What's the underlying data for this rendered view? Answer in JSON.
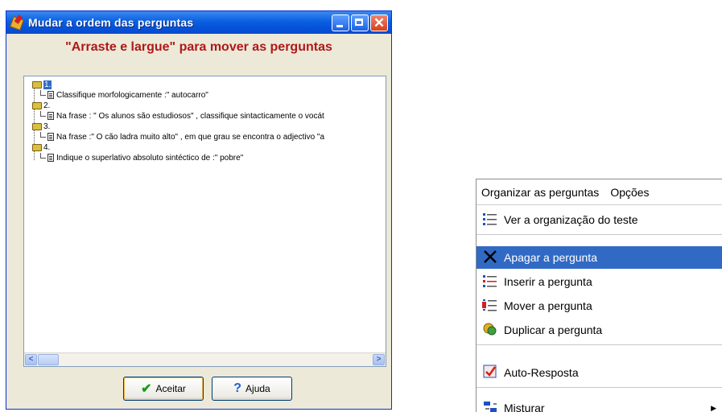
{
  "dialog": {
    "title": "Mudar a ordem das perguntas",
    "heading": "\"Arraste e largue\" para mover as perguntas",
    "questions": [
      {
        "number": "1.",
        "text": "Classifique morfologicamente :\" autocarro\""
      },
      {
        "number": "2.",
        "text": "Na frase : \" Os alunos são estudiosos\" , classifique sintacticamente  o vocát"
      },
      {
        "number": "3.",
        "text": "Na frase :\" O cão ladra muito alto\" , em que grau se encontra o adjectivo \"a"
      },
      {
        "number": "4.",
        "text": "Indique o superlativo absoluto sintéctico de :\" pobre\""
      }
    ],
    "buttons": {
      "ok": "Aceitar",
      "help": "Ajuda"
    }
  },
  "menu": {
    "menubar": [
      "Organizar as perguntas",
      "Opções"
    ],
    "items": [
      {
        "label": "Ver a organização do teste",
        "icon": "list-icon"
      },
      {
        "label": "Apagar a pergunta",
        "icon": "delete-icon"
      },
      {
        "label": "Inserir a pergunta",
        "icon": "insert-icon"
      },
      {
        "label": "Mover a pergunta",
        "icon": "move-icon"
      },
      {
        "label": "Duplicar a pergunta",
        "icon": "duplicate-icon"
      },
      {
        "label": "Auto-Resposta",
        "icon": "auto-answer-icon"
      },
      {
        "label": "Misturar",
        "icon": "shuffle-icon"
      }
    ]
  },
  "colors": {
    "highlight": "#316ac5",
    "heading": "#b01818",
    "titlebar": "#0a5fe0"
  }
}
